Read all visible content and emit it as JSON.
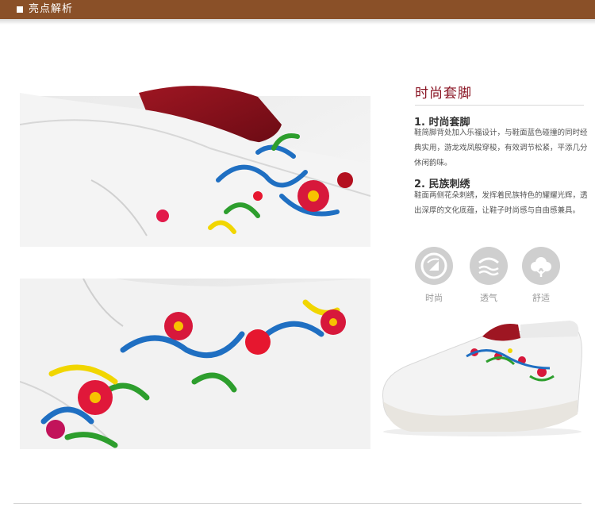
{
  "header": {
    "title": "亮点解析",
    "bar_color": "#8a5028"
  },
  "feature_section": {
    "title": "时尚套脚",
    "title_color": "#8a1524",
    "items": [
      {
        "heading": "1. 时尚套脚",
        "description": "鞋简脚背处加入乐福设计，与鞋面蓝色碰撞的同时经典实用，游龙戏凤般穿梭，有效调节松紧，平添几分休闲韵味。"
      },
      {
        "heading": "2. 民族刺绣",
        "description": "鞋面两侧花朵刺绣，发挥着民族特色的耀耀光辉，透出深厚的文化底蕴，让鞋子时尚感与自由感兼具。"
      }
    ]
  },
  "badges": [
    {
      "icon": "fashion-icon",
      "label": "时尚"
    },
    {
      "icon": "breathable-icon",
      "label": "透气"
    },
    {
      "icon": "comfort-cotton-icon",
      "label": "舒适"
    }
  ],
  "photos": [
    {
      "subject": "embroidery-closeup-with-red-lining"
    },
    {
      "subject": "embroidery-closeup-side"
    },
    {
      "subject": "white-slip-on-shoe-full-view"
    }
  ]
}
